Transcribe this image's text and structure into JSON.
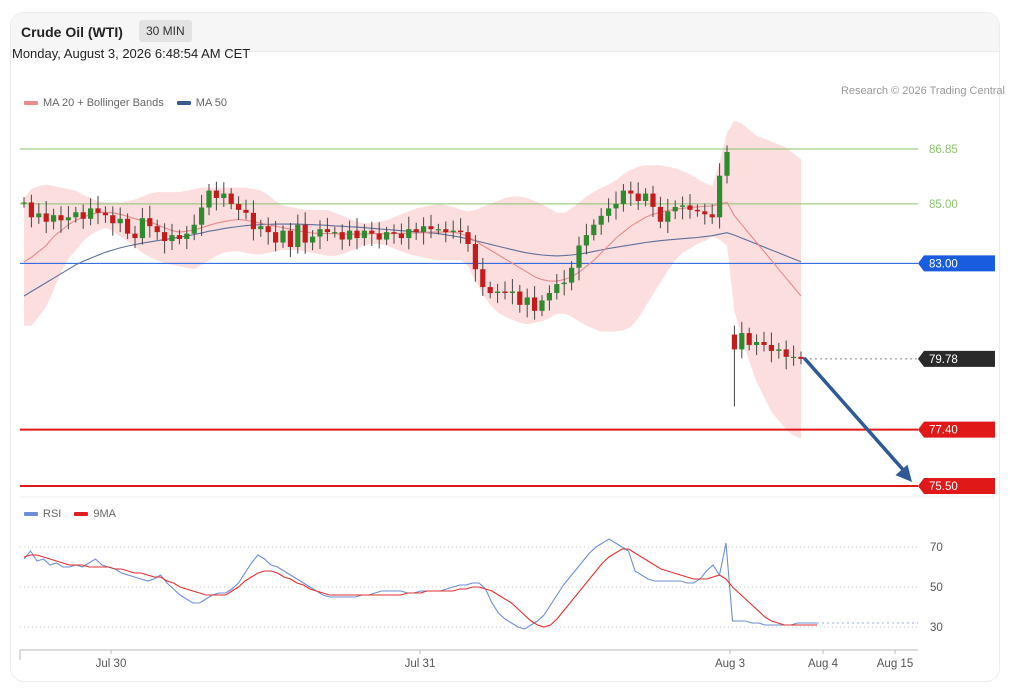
{
  "header": {
    "title": "Crude Oil (WTI)",
    "interval": "30 MIN",
    "datetime": "Monday, August 3, 2026 6:48:54 AM CET",
    "copyright": "Research © 2026 Trading Central"
  },
  "legend_main": [
    {
      "label": "MA 20 + Bollinger Bands",
      "color": "#f08a8a"
    },
    {
      "label": "MA 50",
      "color": "#3a5a96"
    }
  ],
  "legend_rsi": [
    {
      "label": "RSI",
      "color": "#6d8fd6"
    },
    {
      "label": "9MA",
      "color": "#e02020"
    }
  ],
  "chart_data": [
    {
      "type": "candlestick",
      "panel": "price",
      "x_ticks": [
        "Jul 30",
        "Jul 31",
        "Aug 3",
        "Aug 4",
        "Aug 15"
      ],
      "ylim": [
        74.5,
        88.5
      ],
      "levels": [
        {
          "value": 86.85,
          "label": "86.85",
          "kind": "resistance",
          "color": "#8ac46e"
        },
        {
          "value": 85.0,
          "label": "85.00",
          "kind": "resistance",
          "color": "#8ac46e"
        },
        {
          "value": 83.0,
          "label": "83.00",
          "kind": "pivot",
          "color": "#1a5ce0"
        },
        {
          "value": 79.78,
          "label": "79.78",
          "kind": "last_price",
          "color": "#2a2a2a"
        },
        {
          "value": 77.4,
          "label": "77.40",
          "kind": "support",
          "color": "#e01818"
        },
        {
          "value": 75.5,
          "label": "75.50",
          "kind": "support",
          "color": "#e01818"
        }
      ],
      "forecast_arrow": {
        "from": 79.78,
        "to": 75.5
      },
      "close": [
        85.05,
        84.55,
        84.68,
        84.4,
        84.62,
        84.45,
        84.55,
        84.72,
        84.5,
        84.85,
        84.7,
        84.62,
        84.35,
        84.5,
        84.0,
        83.85,
        84.52,
        84.25,
        84.05,
        83.75,
        83.95,
        83.82,
        84.0,
        84.3,
        84.88,
        85.45,
        85.2,
        85.35,
        85.0,
        84.8,
        84.7,
        84.15,
        84.25,
        84.05,
        83.7,
        84.1,
        83.55,
        84.3,
        83.7,
        83.9,
        84.15,
        84.05,
        84.05,
        83.8,
        84.1,
        83.85,
        84.1,
        84.0,
        83.8,
        84.05,
        84.0,
        83.85,
        84.15,
        84.05,
        84.25,
        84.15,
        84.15,
        84.05,
        84.1,
        84.05,
        83.65,
        82.8,
        82.2,
        82.0,
        82.05,
        82.0,
        82.05,
        81.6,
        81.85,
        81.4,
        81.75,
        82.0,
        82.3,
        82.35,
        82.85,
        83.6,
        83.95,
        84.3,
        84.6,
        84.85,
        85.0,
        85.45,
        85.35,
        85.1,
        85.35,
        84.9,
        84.4,
        84.75,
        84.9,
        84.95,
        84.8,
        84.75,
        84.65,
        84.55,
        85.95,
        86.75,
        80.1,
        80.65,
        80.25,
        80.35,
        80.25,
        80.05,
        80.1,
        79.85,
        79.85,
        79.78
      ],
      "ma20": [
        83.05,
        83.2,
        83.4,
        83.6,
        83.9,
        84.1,
        84.3,
        84.45,
        84.55,
        84.65,
        84.7,
        84.72,
        84.7,
        84.65,
        84.58,
        84.5,
        84.45,
        84.4,
        84.3,
        84.2,
        84.1,
        84.05,
        84.08,
        84.12,
        84.2,
        84.28,
        84.35,
        84.4,
        84.45,
        84.48,
        84.45,
        84.4,
        84.35,
        84.3,
        84.25,
        84.2,
        84.15,
        84.1,
        84.05,
        84.02,
        84.0,
        84.0,
        84.0,
        83.98,
        83.98,
        83.98,
        83.98,
        84.0,
        84.0,
        84.0,
        84.0,
        84.0,
        84.02,
        84.02,
        84.03,
        84.05,
        84.05,
        84.05,
        84.05,
        84.0,
        83.9,
        83.75,
        83.6,
        83.45,
        83.3,
        83.15,
        83.0,
        82.85,
        82.7,
        82.55,
        82.45,
        82.4,
        82.4,
        82.45,
        82.55,
        82.7,
        82.9,
        83.1,
        83.35,
        83.6,
        83.85,
        84.05,
        84.25,
        84.4,
        84.55,
        84.65,
        84.72,
        84.78,
        84.82,
        84.85,
        84.88,
        84.9,
        84.92,
        84.93,
        85.0,
        85.05,
        84.6,
        84.3,
        84.0,
        83.7,
        83.4,
        83.1,
        82.8,
        82.5,
        82.2,
        81.9
      ],
      "ma50": [
        81.9,
        82.05,
        82.2,
        82.35,
        82.5,
        82.65,
        82.8,
        82.95,
        83.07,
        83.17,
        83.27,
        83.37,
        83.45,
        83.52,
        83.58,
        83.63,
        83.68,
        83.72,
        83.76,
        83.8,
        83.84,
        83.88,
        83.92,
        83.97,
        84.02,
        84.08,
        84.12,
        84.17,
        84.21,
        84.24,
        84.27,
        84.29,
        84.3,
        84.31,
        84.32,
        84.32,
        84.32,
        84.32,
        84.31,
        84.3,
        84.29,
        84.28,
        84.26,
        84.25,
        84.23,
        84.22,
        84.2,
        84.18,
        84.16,
        84.14,
        84.12,
        84.1,
        84.08,
        84.06,
        84.04,
        84.02,
        84.0,
        83.96,
        83.92,
        83.88,
        83.82,
        83.76,
        83.7,
        83.64,
        83.58,
        83.52,
        83.46,
        83.4,
        83.35,
        83.31,
        83.28,
        83.26,
        83.25,
        83.26,
        83.28,
        83.31,
        83.35,
        83.4,
        83.45,
        83.5,
        83.54,
        83.58,
        83.62,
        83.66,
        83.7,
        83.73,
        83.76,
        83.79,
        83.81,
        83.83,
        83.85,
        83.87,
        83.9,
        83.93,
        83.98,
        84.03,
        83.95,
        83.85,
        83.75,
        83.65,
        83.55,
        83.45,
        83.35,
        83.25,
        83.15,
        83.05
      ],
      "bb_upper": [
        85.2,
        85.5,
        85.6,
        85.65,
        85.6,
        85.55,
        85.5,
        85.45,
        85.3,
        85.2,
        85.1,
        85.05,
        85.05,
        85.05,
        85.1,
        85.15,
        85.25,
        85.35,
        85.4,
        85.4,
        85.4,
        85.4,
        85.45,
        85.5,
        85.55,
        85.55,
        85.55,
        85.55,
        85.55,
        85.55,
        85.55,
        85.5,
        85.45,
        85.3,
        85.1,
        84.95,
        84.9,
        84.85,
        84.8,
        84.8,
        84.8,
        84.8,
        84.7,
        84.6,
        84.5,
        84.4,
        84.35,
        84.35,
        84.4,
        84.45,
        84.55,
        84.65,
        84.75,
        84.85,
        84.9,
        84.95,
        85.0,
        84.95,
        84.9,
        84.8,
        84.75,
        84.8,
        84.9,
        85.0,
        85.1,
        85.2,
        85.25,
        85.25,
        85.2,
        85.1,
        85.0,
        84.85,
        84.7,
        84.7,
        84.85,
        85.05,
        85.25,
        85.4,
        85.55,
        85.65,
        85.8,
        86.0,
        86.15,
        86.25,
        86.3,
        86.3,
        86.3,
        86.25,
        86.2,
        86.1,
        86.0,
        85.85,
        85.7,
        85.6,
        86.4,
        87.4,
        87.8,
        87.7,
        87.5,
        87.3,
        87.2,
        87.1,
        87.0,
        86.9,
        86.7,
        86.5
      ],
      "bb_lower": [
        80.9,
        80.9,
        81.2,
        81.55,
        82.1,
        82.7,
        83.15,
        83.45,
        83.75,
        83.95,
        84.1,
        84.2,
        84.1,
        83.9,
        83.75,
        83.55,
        83.35,
        83.2,
        83.1,
        83.0,
        82.95,
        82.9,
        82.85,
        82.8,
        82.95,
        83.1,
        83.25,
        83.35,
        83.4,
        83.4,
        83.35,
        83.3,
        83.3,
        83.35,
        83.4,
        83.45,
        83.45,
        83.45,
        83.4,
        83.35,
        83.3,
        83.25,
        83.25,
        83.3,
        83.4,
        83.5,
        83.6,
        83.65,
        83.65,
        83.6,
        83.5,
        83.4,
        83.3,
        83.25,
        83.2,
        83.15,
        83.1,
        83.1,
        83.1,
        83.1,
        82.9,
        82.4,
        81.95,
        81.6,
        81.35,
        81.2,
        81.1,
        81.0,
        80.95,
        81.0,
        81.05,
        81.15,
        81.3,
        81.3,
        81.2,
        81.05,
        80.9,
        80.8,
        80.7,
        80.7,
        80.7,
        80.75,
        80.85,
        81.15,
        81.55,
        81.95,
        82.35,
        82.75,
        83.1,
        83.35,
        83.5,
        83.65,
        83.75,
        83.9,
        83.8,
        83.6,
        81.4,
        80.5,
        79.7,
        79.0,
        78.5,
        78.0,
        77.7,
        77.4,
        77.2,
        77.1
      ]
    },
    {
      "type": "line",
      "panel": "rsi",
      "ylim": [
        22,
        78
      ],
      "y_ticks": [
        "70",
        "50",
        "30"
      ],
      "series": [
        {
          "name": "RSI",
          "values": [
            64,
            68,
            63,
            64,
            61,
            62,
            60,
            60,
            61,
            60,
            62,
            64,
            61,
            60,
            59,
            57,
            56,
            55,
            54,
            53,
            54,
            56,
            52,
            49,
            46,
            44,
            42,
            42,
            44,
            46,
            47,
            47,
            49,
            52,
            57,
            62,
            66,
            64,
            61,
            60,
            58,
            56,
            54,
            52,
            50,
            48,
            46,
            45,
            45,
            45,
            45,
            45,
            46,
            46,
            47,
            48,
            48,
            48,
            48,
            47,
            47,
            48,
            48,
            48,
            48,
            49,
            50,
            51,
            51,
            52,
            52,
            49,
            42,
            37,
            34,
            32,
            30,
            29,
            31,
            33,
            36,
            41,
            46,
            51,
            55,
            59,
            63,
            67,
            70,
            72,
            74,
            72,
            70,
            68,
            58,
            56,
            54,
            53,
            53,
            53,
            53,
            53,
            52,
            52,
            54,
            58,
            61,
            56,
            72,
            33,
            33,
            33,
            32,
            32,
            31,
            31,
            31,
            31,
            31,
            32,
            32,
            32,
            32
          ]
        },
        {
          "name": "9MA",
          "values": [
            65,
            66,
            66,
            65,
            64,
            63,
            62,
            61,
            61,
            61,
            60,
            60,
            60,
            60,
            59,
            59,
            58,
            57,
            57,
            56,
            55,
            55,
            53,
            52,
            50,
            49,
            48,
            47,
            46,
            46,
            46,
            46,
            48,
            50,
            53,
            55,
            57,
            58,
            58,
            57,
            55,
            54,
            52,
            51,
            49,
            48,
            47,
            46,
            46,
            46,
            46,
            46,
            46,
            46,
            46,
            46,
            46,
            46,
            46,
            47,
            47,
            47,
            48,
            48,
            48,
            48,
            48,
            49,
            49,
            50,
            50,
            49,
            48,
            46,
            44,
            42,
            39,
            36,
            33,
            31,
            30,
            31,
            34,
            38,
            42,
            46,
            50,
            54,
            58,
            62,
            65,
            67,
            69,
            69,
            67,
            65,
            63,
            61,
            59,
            58,
            57,
            56,
            55,
            54,
            54,
            54,
            55,
            56,
            54,
            50,
            47,
            44,
            41,
            38,
            35,
            33,
            32,
            31,
            31,
            31,
            31,
            31,
            31
          ]
        }
      ]
    }
  ]
}
